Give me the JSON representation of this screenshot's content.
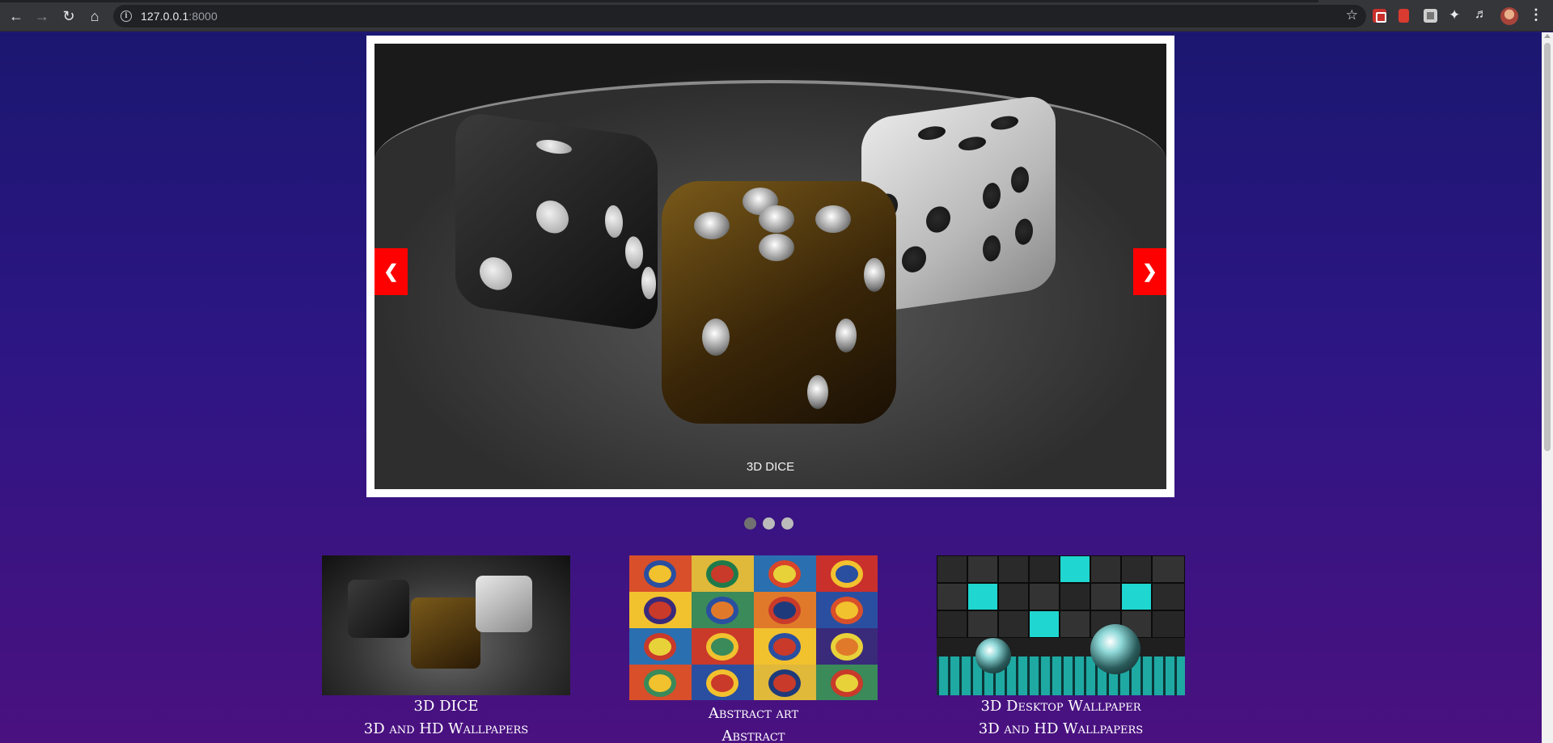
{
  "browser": {
    "url_host": "127.0.0.1",
    "url_port": ":8000",
    "icons": {
      "back": "back-arrow-icon",
      "forward": "forward-arrow-icon",
      "reload": "reload-icon",
      "home": "home-icon",
      "info": "site-info-icon",
      "bookmark": "bookmark-star-icon",
      "extensions": "puzzle-icon",
      "media": "media-control-icon",
      "menu": "kebab-menu-icon"
    }
  },
  "slider": {
    "caption": "3D DICE",
    "prev_label": "❮",
    "next_label": "❯",
    "slide_count": 3,
    "active_index": 0
  },
  "gallery": [
    {
      "title": "3D DICE",
      "category": "3D and HD Wallpapers"
    },
    {
      "title": "Abstract art",
      "category": "Abstract"
    },
    {
      "title": "3D Desktop Wallpaper",
      "category": "3D and HD Wallpapers"
    }
  ],
  "colors": {
    "accent_button": "#ff0000",
    "page_gradient_top": "#1b1770",
    "page_gradient_bottom": "#4a1180"
  }
}
